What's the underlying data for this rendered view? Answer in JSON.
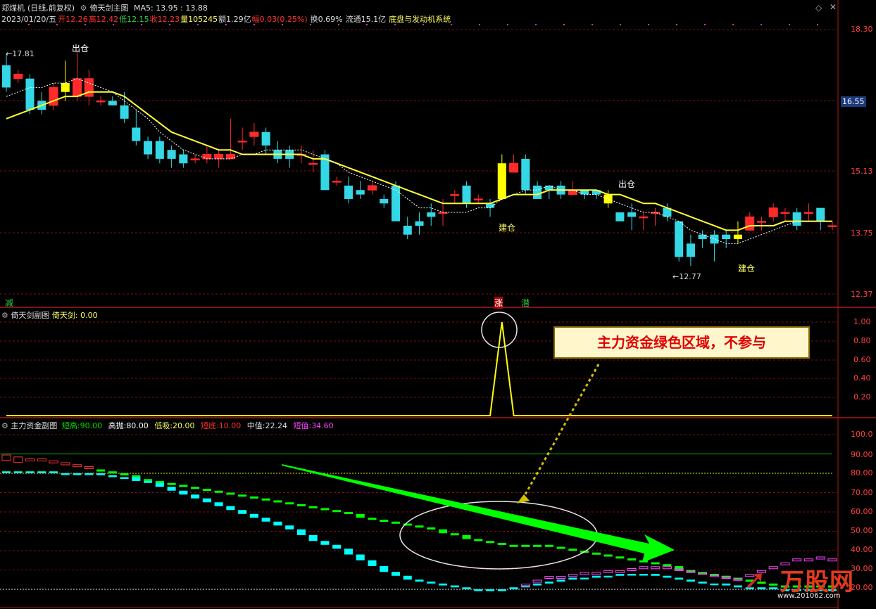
{
  "header": {
    "symbol": "郑煤机",
    "mode": "(日线,前复权)",
    "main_title": "倚天剑主图",
    "ma5": "MA5: 13.95 : 13.88",
    "date": "2023/01/20/五",
    "open_label": "开",
    "open": "12.26",
    "high_label": "高",
    "high": "12.42",
    "low_label": "低",
    "low": "12.15",
    "close_label": "收",
    "close": "12.23",
    "volume_label": "量",
    "volume": "105245",
    "amount_label": "额",
    "amount": "1.29亿",
    "change_label": "幅",
    "change": "0.03(0.25%)",
    "turnover": "换0.69%",
    "float": "流通15.1亿",
    "system": "底盘与发动机系统"
  },
  "main_panel": {
    "y_ticks": [
      "18.30",
      "16.55",
      "15.13",
      "13.75",
      "12.37"
    ],
    "high_marker": "17.81",
    "low_marker": "12.77",
    "labels": [
      {
        "text": "出仓"
      },
      {
        "text": "建仓"
      },
      {
        "text": "出仓"
      },
      {
        "text": "建仓"
      }
    ],
    "bottom_signals": [
      {
        "text": "减",
        "color": "#2ecc40"
      },
      {
        "text": "涨",
        "color": "#ff3030"
      },
      {
        "text": "潜",
        "color": "#2ecc40"
      }
    ]
  },
  "sub1": {
    "title": "倚天剑副图",
    "value_label": "倚天剑: 0.00",
    "y_ticks": [
      "1.00",
      "0.80",
      "0.60",
      "0.40",
      "0.20"
    ]
  },
  "sub2": {
    "title": "主力资金副图",
    "legend": [
      {
        "label": "短高:",
        "value": "90.00",
        "color": "#00e000"
      },
      {
        "label": "高抛:",
        "value": "80.00",
        "color": "#ffffff"
      },
      {
        "label": "低吸:",
        "value": "20.00",
        "color": "#ffff66"
      },
      {
        "label": "短底:",
        "value": "10.00",
        "color": "#ff3030"
      },
      {
        "label": "中值:",
        "value": "22.24",
        "color": "#dddddd"
      },
      {
        "label": "短值:",
        "value": "34.60",
        "color": "#ff44ff"
      }
    ],
    "y_ticks": [
      "100.0",
      "90.00",
      "80.00",
      "70.00",
      "60.00",
      "50.00",
      "40.00",
      "30.00",
      "20.00"
    ]
  },
  "callout": "主力资金绿色区域，不参与",
  "logo": {
    "text": "万股网",
    "url": "www.201062.com"
  },
  "colors": {
    "up": "#ff2a2a",
    "down": "#33d7e6",
    "ma": "#ffff33",
    "signal": "#ffff00",
    "green": "#00ff00",
    "cyan": "#00ffff",
    "magenta": "#ff44ff"
  },
  "chart_data": [
    {
      "type": "candlestick",
      "title": "倚天剑主图",
      "ylim": [
        12.2,
        18.5
      ],
      "candles": [
        [
          17.5,
          17.0,
          17.75,
          16.9
        ],
        [
          17.2,
          17.3,
          17.4,
          17.1
        ],
        [
          17.2,
          16.5,
          17.3,
          16.4
        ],
        [
          16.7,
          16.5,
          16.9,
          16.4
        ],
        [
          16.6,
          17.0,
          17.1,
          16.5
        ],
        [
          17.1,
          16.9,
          17.6,
          16.7
        ],
        [
          16.8,
          17.2,
          17.81,
          16.7
        ],
        [
          16.8,
          17.2,
          17.4,
          16.6
        ],
        [
          16.7,
          16.7,
          16.8,
          16.6
        ],
        [
          16.7,
          16.6,
          16.8,
          16.6
        ],
        [
          16.6,
          16.3,
          16.9,
          16.2
        ],
        [
          16.1,
          15.8,
          16.5,
          15.7
        ],
        [
          15.8,
          15.5,
          15.9,
          15.4
        ],
        [
          15.8,
          15.4,
          15.9,
          15.3
        ],
        [
          15.6,
          15.4,
          15.7,
          15.2
        ],
        [
          15.5,
          15.3,
          15.6,
          15.2
        ],
        [
          15.4,
          15.4,
          15.5,
          15.3
        ],
        [
          15.4,
          15.5,
          15.7,
          15.3
        ],
        [
          15.4,
          15.5,
          15.6,
          15.2
        ],
        [
          15.4,
          15.5,
          16.3,
          15.4
        ],
        [
          15.8,
          15.8,
          16.1,
          15.6
        ],
        [
          15.9,
          16.0,
          16.2,
          15.7
        ],
        [
          16.0,
          15.7,
          16.1,
          15.5
        ],
        [
          15.6,
          15.4,
          15.8,
          15.3
        ],
        [
          15.6,
          15.4,
          15.7,
          15.2
        ],
        [
          15.5,
          15.5,
          15.7,
          15.3
        ],
        [
          15.3,
          15.3,
          15.6,
          15.1
        ],
        [
          15.5,
          14.7,
          15.6,
          14.7
        ],
        [
          14.9,
          14.9,
          15.0,
          14.8
        ],
        [
          14.8,
          14.5,
          15.0,
          14.4
        ],
        [
          14.7,
          14.6,
          14.9,
          14.5
        ],
        [
          14.7,
          14.8,
          14.9,
          14.6
        ],
        [
          14.5,
          14.4,
          14.6,
          14.3
        ],
        [
          14.8,
          14.0,
          14.9,
          14.0
        ],
        [
          13.9,
          13.7,
          14.1,
          13.6
        ],
        [
          14.0,
          13.9,
          14.2,
          13.7
        ],
        [
          14.2,
          14.1,
          14.4,
          13.9
        ],
        [
          14.2,
          14.2,
          14.5,
          13.9
        ],
        [
          14.6,
          14.6,
          14.7,
          14.4
        ],
        [
          14.8,
          14.4,
          14.9,
          14.3
        ],
        [
          14.5,
          14.5,
          14.6,
          14.4
        ],
        [
          14.4,
          14.3,
          14.5,
          14.1
        ],
        [
          14.5,
          15.3,
          15.5,
          14.5
        ],
        [
          15.1,
          15.3,
          15.5,
          15.1
        ],
        [
          15.4,
          14.7,
          15.5,
          14.6
        ],
        [
          14.8,
          14.5,
          14.9,
          14.5
        ],
        [
          14.8,
          14.7,
          14.8,
          14.5
        ],
        [
          14.8,
          14.6,
          14.9,
          14.5
        ],
        [
          14.6,
          14.7,
          14.9,
          14.6
        ],
        [
          14.7,
          14.6,
          14.7,
          14.5
        ],
        [
          14.7,
          14.6,
          14.7,
          14.5
        ],
        [
          14.6,
          14.4,
          14.7,
          14.3
        ],
        [
          14.2,
          14.0,
          14.2,
          14.0
        ],
        [
          14.2,
          14.1,
          14.4,
          13.8
        ],
        [
          14.1,
          14.1,
          14.2,
          13.8
        ],
        [
          14.2,
          14.2,
          14.3,
          13.9
        ],
        [
          14.3,
          14.1,
          14.4,
          14.0
        ],
        [
          14.0,
          13.2,
          14.0,
          13.1
        ],
        [
          13.5,
          13.2,
          13.7,
          13.0
        ],
        [
          13.7,
          13.6,
          13.8,
          13.4
        ],
        [
          13.7,
          13.5,
          13.8,
          13.1
        ],
        [
          13.7,
          13.6,
          13.8,
          13.4
        ],
        [
          13.6,
          13.7,
          14.0,
          13.5
        ],
        [
          13.8,
          14.1,
          14.2,
          13.8
        ],
        [
          14.0,
          14.0,
          14.1,
          13.8
        ],
        [
          14.1,
          14.3,
          14.4,
          14.0
        ],
        [
          14.2,
          14.2,
          14.3,
          14.0
        ],
        [
          14.2,
          13.9,
          14.3,
          13.8
        ],
        [
          14.2,
          14.2,
          14.4,
          14.0
        ],
        [
          14.3,
          14.0,
          14.3,
          13.8
        ],
        [
          13.9,
          13.9,
          14.0,
          13.8
        ]
      ],
      "ma5": [
        16.8,
        16.9,
        17.0,
        17.0,
        17.1,
        17.1,
        17.2,
        17.1,
        17.0,
        16.9,
        16.7,
        16.5,
        16.3,
        16.0,
        15.8,
        15.6,
        15.5,
        15.4,
        15.4,
        15.4,
        15.5,
        15.5,
        15.6,
        15.6,
        15.6,
        15.6,
        15.5,
        15.4,
        15.3,
        15.1,
        15.0,
        14.9,
        14.8,
        14.7,
        14.5,
        14.3,
        14.3,
        14.2,
        14.2,
        14.2,
        14.3,
        14.3,
        14.5,
        14.6,
        14.7,
        14.7,
        14.8,
        14.7,
        14.7,
        14.6,
        14.6,
        14.5,
        14.4,
        14.3,
        14.2,
        14.2,
        14.1,
        14.0,
        13.8,
        13.7,
        13.6,
        13.5,
        13.5,
        13.6,
        13.7,
        13.8,
        13.9,
        14.0,
        14.0,
        14.0,
        14.0
      ],
      "ma_long": [
        16.3,
        16.4,
        16.5,
        16.6,
        16.7,
        16.8,
        16.8,
        16.9,
        16.9,
        16.9,
        16.8,
        16.6,
        16.4,
        16.2,
        16.0,
        15.9,
        15.8,
        15.7,
        15.6,
        15.6,
        15.5,
        15.5,
        15.5,
        15.5,
        15.5,
        15.5,
        15.4,
        15.4,
        15.3,
        15.2,
        15.1,
        15.0,
        14.9,
        14.8,
        14.7,
        14.6,
        14.5,
        14.4,
        14.4,
        14.4,
        14.4,
        14.4,
        14.5,
        14.6,
        14.6,
        14.6,
        14.7,
        14.7,
        14.7,
        14.7,
        14.7,
        14.6,
        14.6,
        14.5,
        14.4,
        14.4,
        14.3,
        14.2,
        14.1,
        14.0,
        13.9,
        13.8,
        13.8,
        13.9,
        13.9,
        13.9,
        14.0,
        14.0,
        14.0,
        14.0,
        14.0
      ]
    },
    {
      "type": "line",
      "title": "倚天剑副图",
      "ylim": [
        0,
        1.1
      ],
      "values": [
        0,
        0,
        0,
        0,
        0,
        0,
        0,
        0,
        0,
        0,
        0,
        0,
        0,
        0,
        0,
        0,
        0,
        0,
        0,
        0,
        0,
        0,
        0,
        0,
        0,
        0,
        0,
        0,
        0,
        0,
        0,
        0,
        0,
        0,
        0,
        0,
        0,
        0,
        0,
        0,
        0,
        0,
        1.0,
        0,
        0,
        0,
        0,
        0,
        0,
        0,
        0,
        0,
        0,
        0,
        0,
        0,
        0,
        0,
        0,
        0,
        0,
        0,
        0,
        0,
        0,
        0,
        0,
        0,
        0,
        0,
        0
      ]
    },
    {
      "type": "bar",
      "title": "主力资金副图",
      "ylim": [
        10,
        103
      ],
      "levels": {
        "短高": 90.0,
        "高抛": 80.0,
        "低吸": 20.0,
        "短底": 10.0,
        "中值": 22.24,
        "短值": 34.6
      },
      "green": [
        88,
        87,
        86,
        86,
        85,
        84,
        83,
        82,
        81,
        80,
        79,
        77,
        76,
        75,
        74,
        73,
        72,
        71,
        70,
        69,
        68,
        67,
        66,
        65,
        64,
        63,
        62,
        61,
        60,
        59,
        57,
        56,
        55,
        54,
        53,
        52,
        51,
        49,
        48,
        46,
        45,
        44,
        43,
        43,
        43,
        43,
        42,
        41,
        40,
        39,
        38,
        37,
        36,
        35,
        34,
        33,
        32,
        30,
        29,
        28,
        27,
        26,
        25,
        24,
        23,
        22,
        22,
        22,
        22,
        22,
        22
      ],
      "cyan": [
        81,
        81,
        81,
        81,
        80,
        80,
        80,
        80,
        79,
        78,
        78,
        76,
        75,
        73,
        71,
        69,
        67,
        65,
        63,
        61,
        59,
        57,
        55,
        53,
        51,
        48,
        45,
        43,
        41,
        38,
        35,
        32,
        29,
        27,
        25,
        24,
        23,
        22,
        21,
        20,
        20,
        20,
        20,
        21,
        22,
        23,
        24,
        25,
        26,
        26,
        27,
        27,
        28,
        28,
        28,
        27,
        26,
        25,
        24,
        23,
        23,
        22,
        21,
        21,
        21,
        20,
        20,
        20,
        20,
        20,
        20
      ],
      "magenta": [
        0,
        0,
        0,
        0,
        0,
        0,
        0,
        0,
        0,
        0,
        0,
        0,
        0,
        0,
        0,
        0,
        0,
        0,
        0,
        0,
        0,
        0,
        0,
        0,
        0,
        0,
        0,
        0,
        0,
        0,
        0,
        0,
        0,
        0,
        0,
        0,
        0,
        0,
        0,
        0,
        0,
        0,
        0,
        0,
        22,
        24,
        26,
        26,
        27,
        28,
        28,
        29,
        29,
        30,
        31,
        31,
        31,
        30,
        29,
        28,
        27,
        26,
        25,
        27,
        29,
        31,
        33,
        35,
        35,
        36,
        35
      ]
    }
  ]
}
